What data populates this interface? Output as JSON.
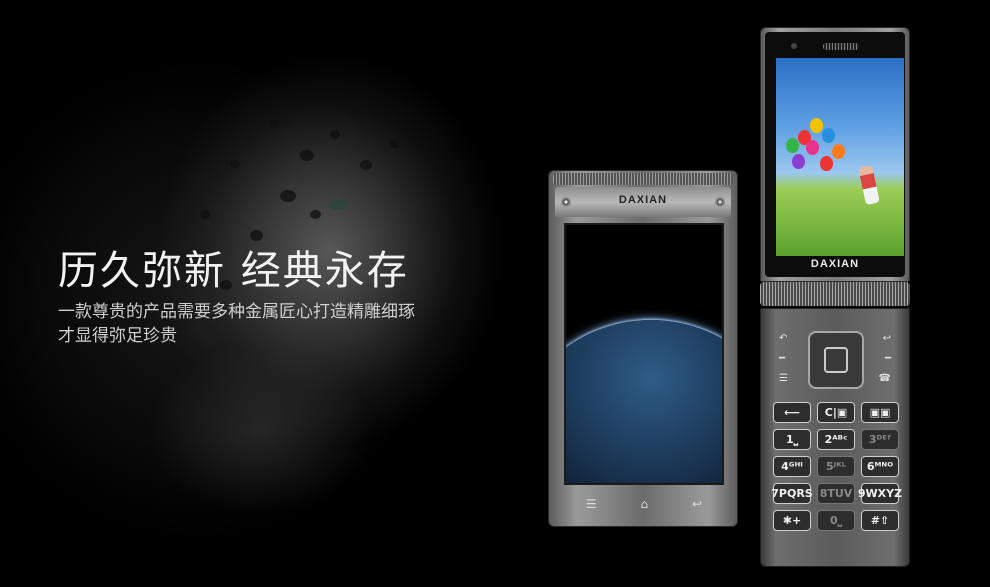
{
  "headline": "历久弥新 经典永存",
  "description_line1": "一款尊贵的产品需要多种金属匠心打造精雕细琢",
  "description_line2": "才显得弥足珍贵",
  "front_phone": {
    "brand": "DAXIAN",
    "softkeys": [
      "menu-icon",
      "home-icon",
      "back-icon"
    ]
  },
  "flip_phone": {
    "brand": "DAXIAN",
    "keypad": [
      {
        "label": "⟵"
      },
      {
        "label": "C|▣"
      },
      {
        "label": "▣▣"
      },
      {
        "label": "1⎵"
      },
      {
        "label": "2ᴬᴮᶜ"
      },
      {
        "label": "3ᴰᴱᶠ"
      },
      {
        "label": "4ᴳᴴᴵ"
      },
      {
        "label": "5ᴶᴷᴸ"
      },
      {
        "label": "6ᴹᴺᴼ"
      },
      {
        "label": "7PQRS"
      },
      {
        "label": "8TUV"
      },
      {
        "label": "9WXYZ"
      },
      {
        "label": "✱+"
      },
      {
        "label": "0⎵"
      },
      {
        "label": "#⇧"
      }
    ]
  },
  "colors": {
    "background": "#000000",
    "title_text": "#f2f2f2",
    "subtitle_text": "#cfcfcf"
  }
}
